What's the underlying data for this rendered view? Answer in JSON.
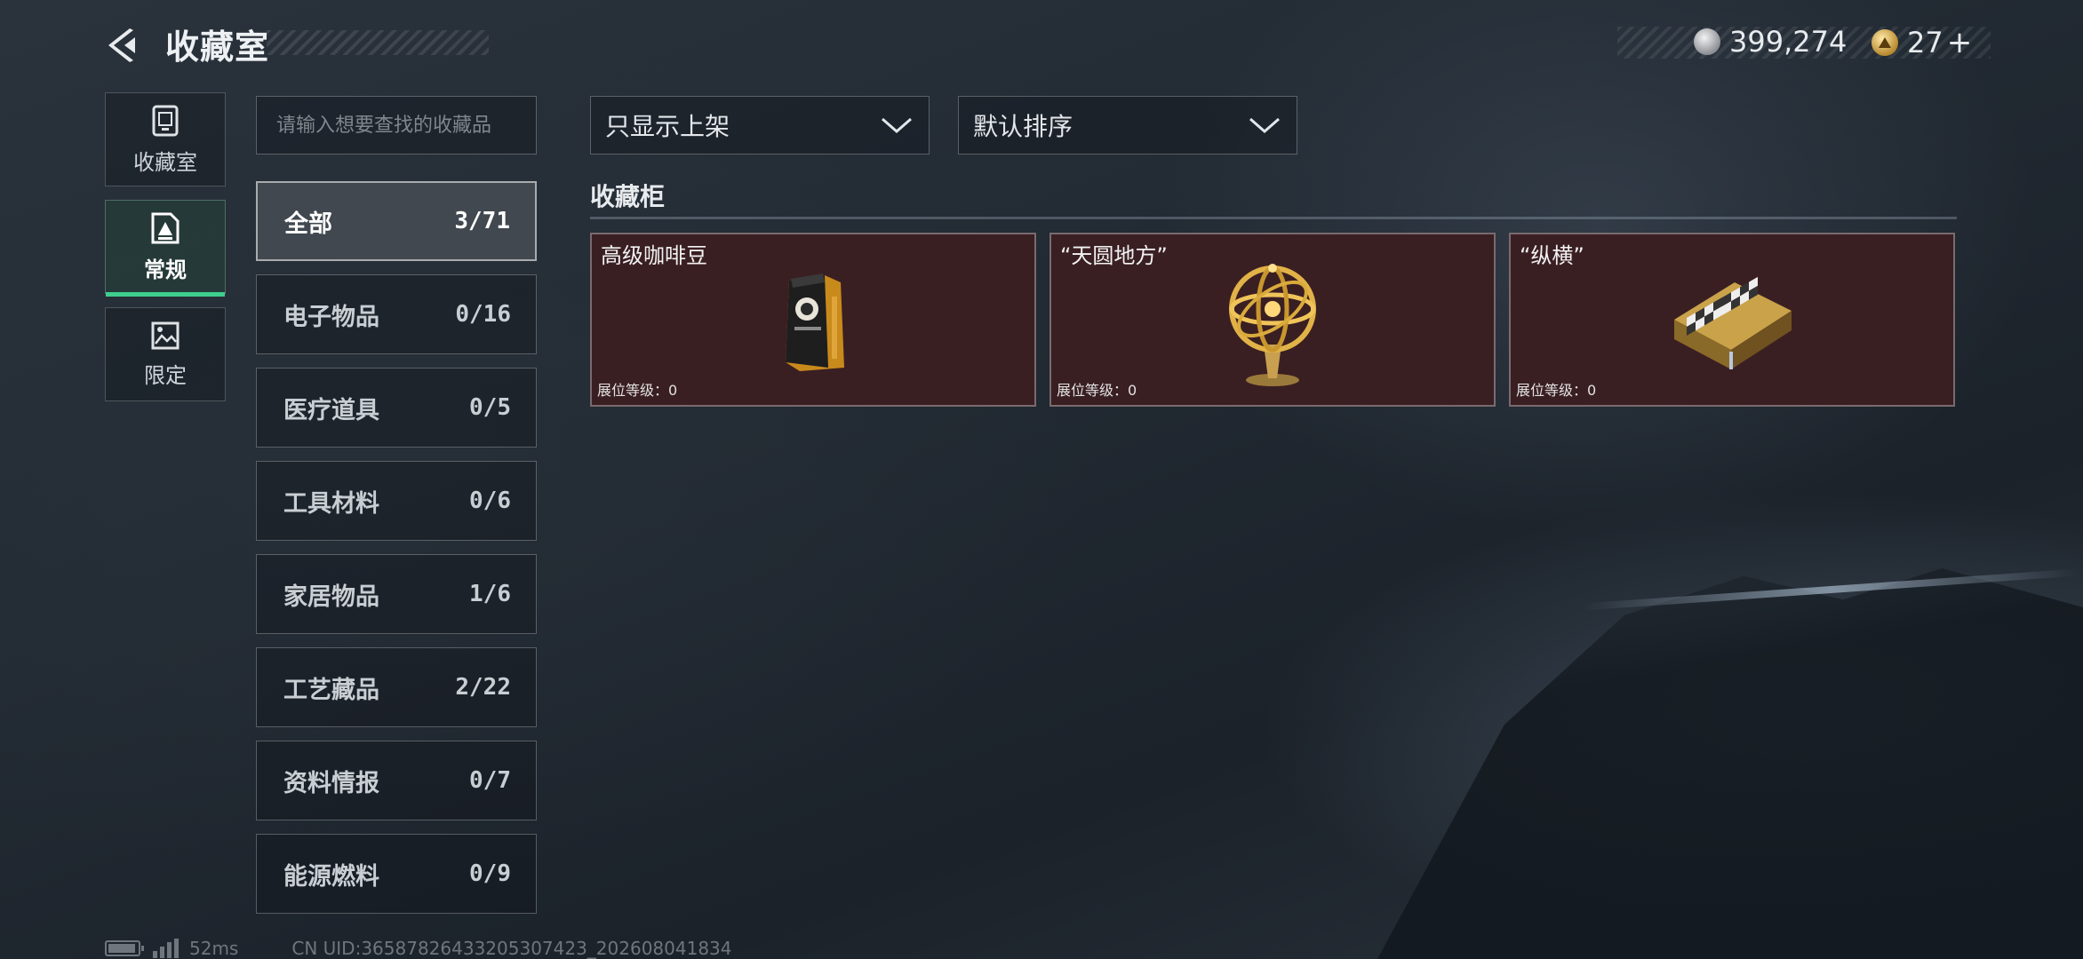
{
  "header": {
    "title": "收藏室",
    "currency": [
      {
        "icon": "silver-coin-icon",
        "value": "399,274"
      },
      {
        "icon": "gold-token-icon",
        "value": "27"
      }
    ],
    "add_label": "+"
  },
  "side_tabs": [
    {
      "label": "收藏室",
      "icon": "cabinet-icon",
      "active": false
    },
    {
      "label": "常规",
      "icon": "document-icon",
      "active": true
    },
    {
      "label": "限定",
      "icon": "picture-icon",
      "active": false
    }
  ],
  "search": {
    "placeholder": "请输入想要查找的收藏品",
    "value": ""
  },
  "categories": [
    {
      "name": "全部",
      "count": "3/71",
      "active": true
    },
    {
      "name": "电子物品",
      "count": "0/16"
    },
    {
      "name": "医疗道具",
      "count": "0/5"
    },
    {
      "name": "工具材料",
      "count": "0/6"
    },
    {
      "name": "家居物品",
      "count": "1/6"
    },
    {
      "name": "工艺藏品",
      "count": "2/22"
    },
    {
      "name": "资料情报",
      "count": "0/7"
    },
    {
      "name": "能源燃料",
      "count": "0/9"
    }
  ],
  "filters": {
    "display": {
      "selected": "只显示上架",
      "icon": "chevron-down-icon"
    },
    "sort": {
      "selected": "默认排序",
      "icon": "chevron-down-icon"
    }
  },
  "cabinet": {
    "title": "收藏柜",
    "items": [
      {
        "name": "高级咖啡豆",
        "level_label": "展位等级：",
        "level": "0",
        "icon": "coffee-bag-icon"
      },
      {
        "name": "“天圆地方”",
        "level_label": "展位等级：",
        "level": "0",
        "icon": "armillary-sphere-icon"
      },
      {
        "name": "“纵横”",
        "level_label": "展位等级：",
        "level": "0",
        "icon": "chess-board-icon"
      }
    ]
  },
  "footer": {
    "ping": "52ms",
    "uid": "CN UID:36587826433205307423_202608041834"
  },
  "colors": {
    "accent": "#3ecf8e",
    "card_bg": "#3a1f22"
  }
}
